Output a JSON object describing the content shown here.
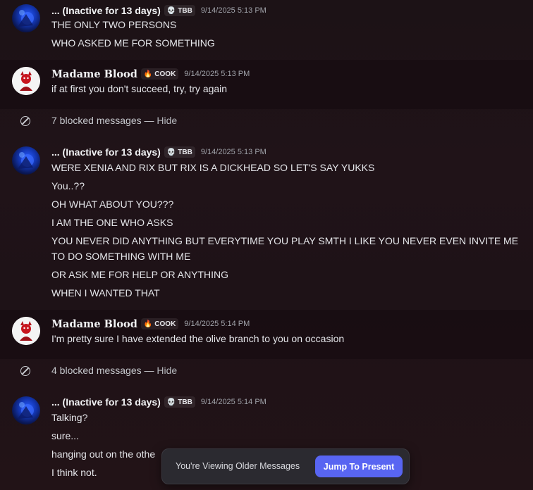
{
  "messages": [
    {
      "author": "... (Inactive for 13 days)",
      "tag": "TBB",
      "tag_icon": "skull-emoji",
      "time": "9/14/2025 5:13 PM",
      "lines": [
        "THE ONLY TWO PERSONS",
        "WHO ASKED ME FOR SOMETHING"
      ]
    },
    {
      "author": "Madame Blood",
      "tag": "COOK",
      "tag_icon": "fire-emoji",
      "time": "9/14/2025 5:13 PM",
      "lines": [
        "if at first you don't succeed, try, try again"
      ]
    },
    {
      "author": "... (Inactive for 13 days)",
      "tag": "TBB",
      "tag_icon": "skull-emoji",
      "time": "9/14/2025 5:13 PM",
      "lines": [
        "WERE XENIA AND RIX BUT RIX IS A DICKHEAD SO LET'S SAY YUKKS",
        "You..??",
        "OH WHAT ABOUT YOU???",
        "I AM THE ONE WHO ASKS",
        "YOU NEVER DID ANYTHING BUT EVERYTIME YOU PLAY SMTH I LIKE YOU NEVER EVEN INVITE ME TO DO SOMETHING WITH ME",
        "OR ASK ME FOR HELP OR ANYTHING",
        "WHEN I WANTED THAT"
      ]
    },
    {
      "author": "Madame Blood",
      "tag": "COOK",
      "tag_icon": "fire-emoji",
      "time": "9/14/2025 5:14 PM",
      "lines": [
        "I'm pretty sure I have extended the olive branch to you on occasion"
      ]
    },
    {
      "author": "... (Inactive for 13 days)",
      "tag": "TBB",
      "tag_icon": "skull-emoji",
      "time": "9/14/2025 5:14 PM",
      "lines": [
        "Talking?",
        "sure...",
        "hanging out on the othe",
        "I think not."
      ]
    }
  ],
  "blocked": [
    {
      "text": "7 blocked messages — ",
      "hide": "Hide"
    },
    {
      "text": "4 blocked messages — ",
      "hide": "Hide"
    }
  ],
  "toast": {
    "text": "You're Viewing Older Messages",
    "button": "Jump To Present"
  },
  "colors": {
    "accent": "#5865f2",
    "background": "#1e1217"
  }
}
